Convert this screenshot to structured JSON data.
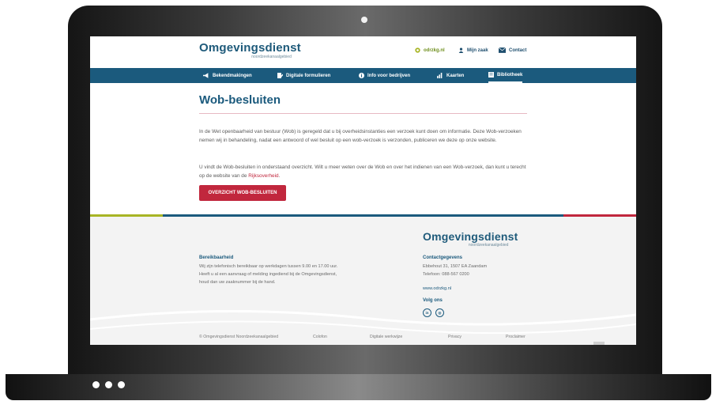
{
  "site": {
    "logo_main": "Omgevingsdienst",
    "logo_sub": "noordzeekanaalgebied"
  },
  "header": {
    "odr_link": "odrzkg.nl",
    "mijn_zaak": "Mijn zaak",
    "contact": "Contact"
  },
  "nav": {
    "items": [
      {
        "label": "Bekendmakingen",
        "icon": "megaphone-icon"
      },
      {
        "label": "Digitale formulieren",
        "icon": "form-pen-icon"
      },
      {
        "label": "Info voor bedrijven",
        "icon": "info-circle-icon"
      },
      {
        "label": "Kaarten",
        "icon": "map-pin-icon"
      },
      {
        "label": "Bibliotheek",
        "icon": "book-icon"
      }
    ],
    "active": "Bibliotheek"
  },
  "main": {
    "title": "Wob-besluiten",
    "paragraph1": "In de Wet openbaarheid van bestuur (Wob) is geregeld dat u bij overheidsinstanties een verzoek kunt doen om informatie. Deze Wob-verzoeken nemen wij in behandeling, nadat een antwoord of wel besluit op een wob-verzoek is verzonden, publiceren we deze op onze website.",
    "paragraph2_before": "U vindt de Wob-besluiten in onderstaand overzicht. Wilt u meer weten over de Wob en over het indienen van een Wob-verzoek, dan kunt u terecht op de website van de ",
    "paragraph2_link": "Rijksoverheid",
    "paragraph2_after": ".",
    "cta_label": "OVERZICHT WOB-BESLUITEN"
  },
  "colors": {
    "primary": "#1b5a7d",
    "accent_red": "#c1273d",
    "accent_green": "#a8b525"
  },
  "footer": {
    "bereik_title": "Bereikbaarheid",
    "bereik_line1": "Wij zijn telefonisch bereikbaar op werkdagen tussen 9.00 en 17.00 uur.",
    "bereik_line2": "Heeft u al een aanvraag of melding ingediend bij de Omgevingsdienst,",
    "bereik_line3": "houd dan uw zaaknummer bij de hand.",
    "contact_title": "Contactgegevens",
    "address": "Ebbehout 31, 1507 EA Zaandam",
    "phone": "Telefoon: 088-567 0200",
    "website": "www.odrzkg.nl",
    "volg_title": "Volg ons",
    "social": [
      {
        "label": "in",
        "icon": "linkedin-icon"
      },
      {
        "label": "◎",
        "icon": "instagram-icon"
      }
    ],
    "bottom": {
      "copyright": "© Omgevingsdienst Noordzeekanaalgebied",
      "colofon": "Colofon",
      "digitale": "Digitale werkwijze",
      "privacy": "Privacy",
      "proclaimer": "Proclaimer"
    }
  }
}
